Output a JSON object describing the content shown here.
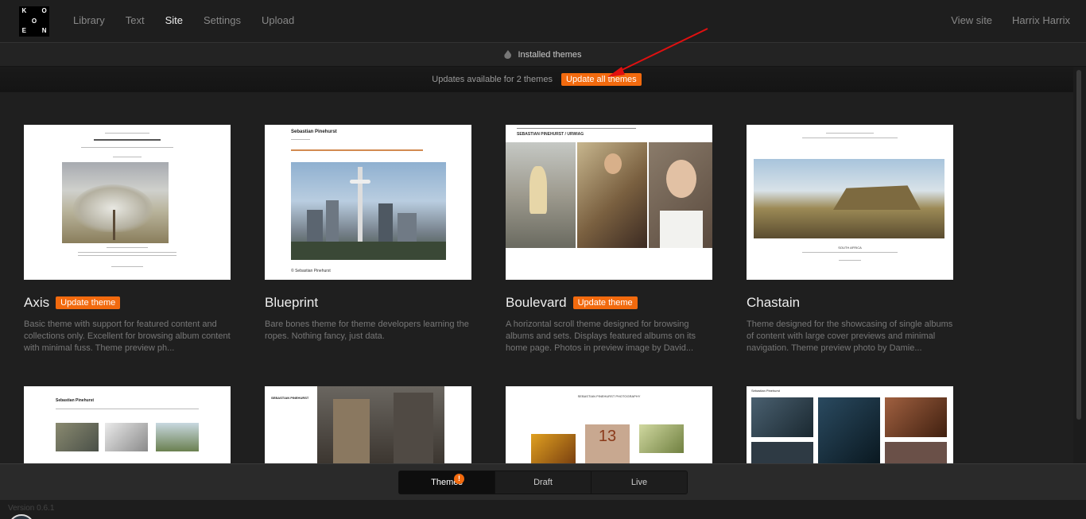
{
  "logo": {
    "letters": [
      "K",
      "",
      "O",
      "",
      "O",
      "",
      "E",
      "",
      "N"
    ]
  },
  "nav": {
    "items": [
      "Library",
      "Text",
      "Site",
      "Settings",
      "Upload"
    ],
    "active": "Site",
    "view_site": "View site",
    "user": "Harrix Harrix"
  },
  "subbar": {
    "title": "Installed themes"
  },
  "updates": {
    "text": "Updates available for 2 themes",
    "button": "Update all themes"
  },
  "themes": [
    {
      "name": "Axis",
      "update_label": "Update theme",
      "desc": "Basic theme with support for featured content and collections only. Excellent for browsing album content with minimal fuss. Theme preview ph..."
    },
    {
      "name": "Blueprint",
      "update_label": "",
      "desc": "Bare bones theme for theme developers learning the ropes. Nothing fancy, just data.",
      "thumb_title": "Sebastian Pinehurst",
      "thumb_footer": "© Sebastian Pinehurst"
    },
    {
      "name": "Boulevard",
      "update_label": "Update theme",
      "desc": "A horizontal scroll theme designed for browsing albums and sets. Displays featured albums on its home page. Photos in preview image by David...",
      "thumb_title": "SEBASTIAN PINEHURST / URWIAG"
    },
    {
      "name": "Chastain",
      "update_label": "",
      "desc": "Theme designed for the showcasing of single albums of content with large cover previews and minimal navigation. Theme preview photo by Damie...",
      "thumb_caption": "SOUTH AFRICA"
    }
  ],
  "more_themes": [
    {
      "thumb_title": "Sebastian Pinehurst"
    },
    {
      "thumb_title": "SEBASTIAN PINEHURST"
    },
    {
      "thumb_title": "SEBASTIAN PINEHURST PHOTOGRAPHY",
      "thumb_number": "13"
    },
    {
      "thumb_title": "Sebastian Pinehurst"
    }
  ],
  "bottom_tabs": {
    "themes": "Themes",
    "draft": "Draft",
    "live": "Live",
    "badge": "!"
  },
  "footer": {
    "version": "Version 0.6.1"
  },
  "colors": {
    "accent": "#f26a0e",
    "background": "#1f1f1f"
  }
}
